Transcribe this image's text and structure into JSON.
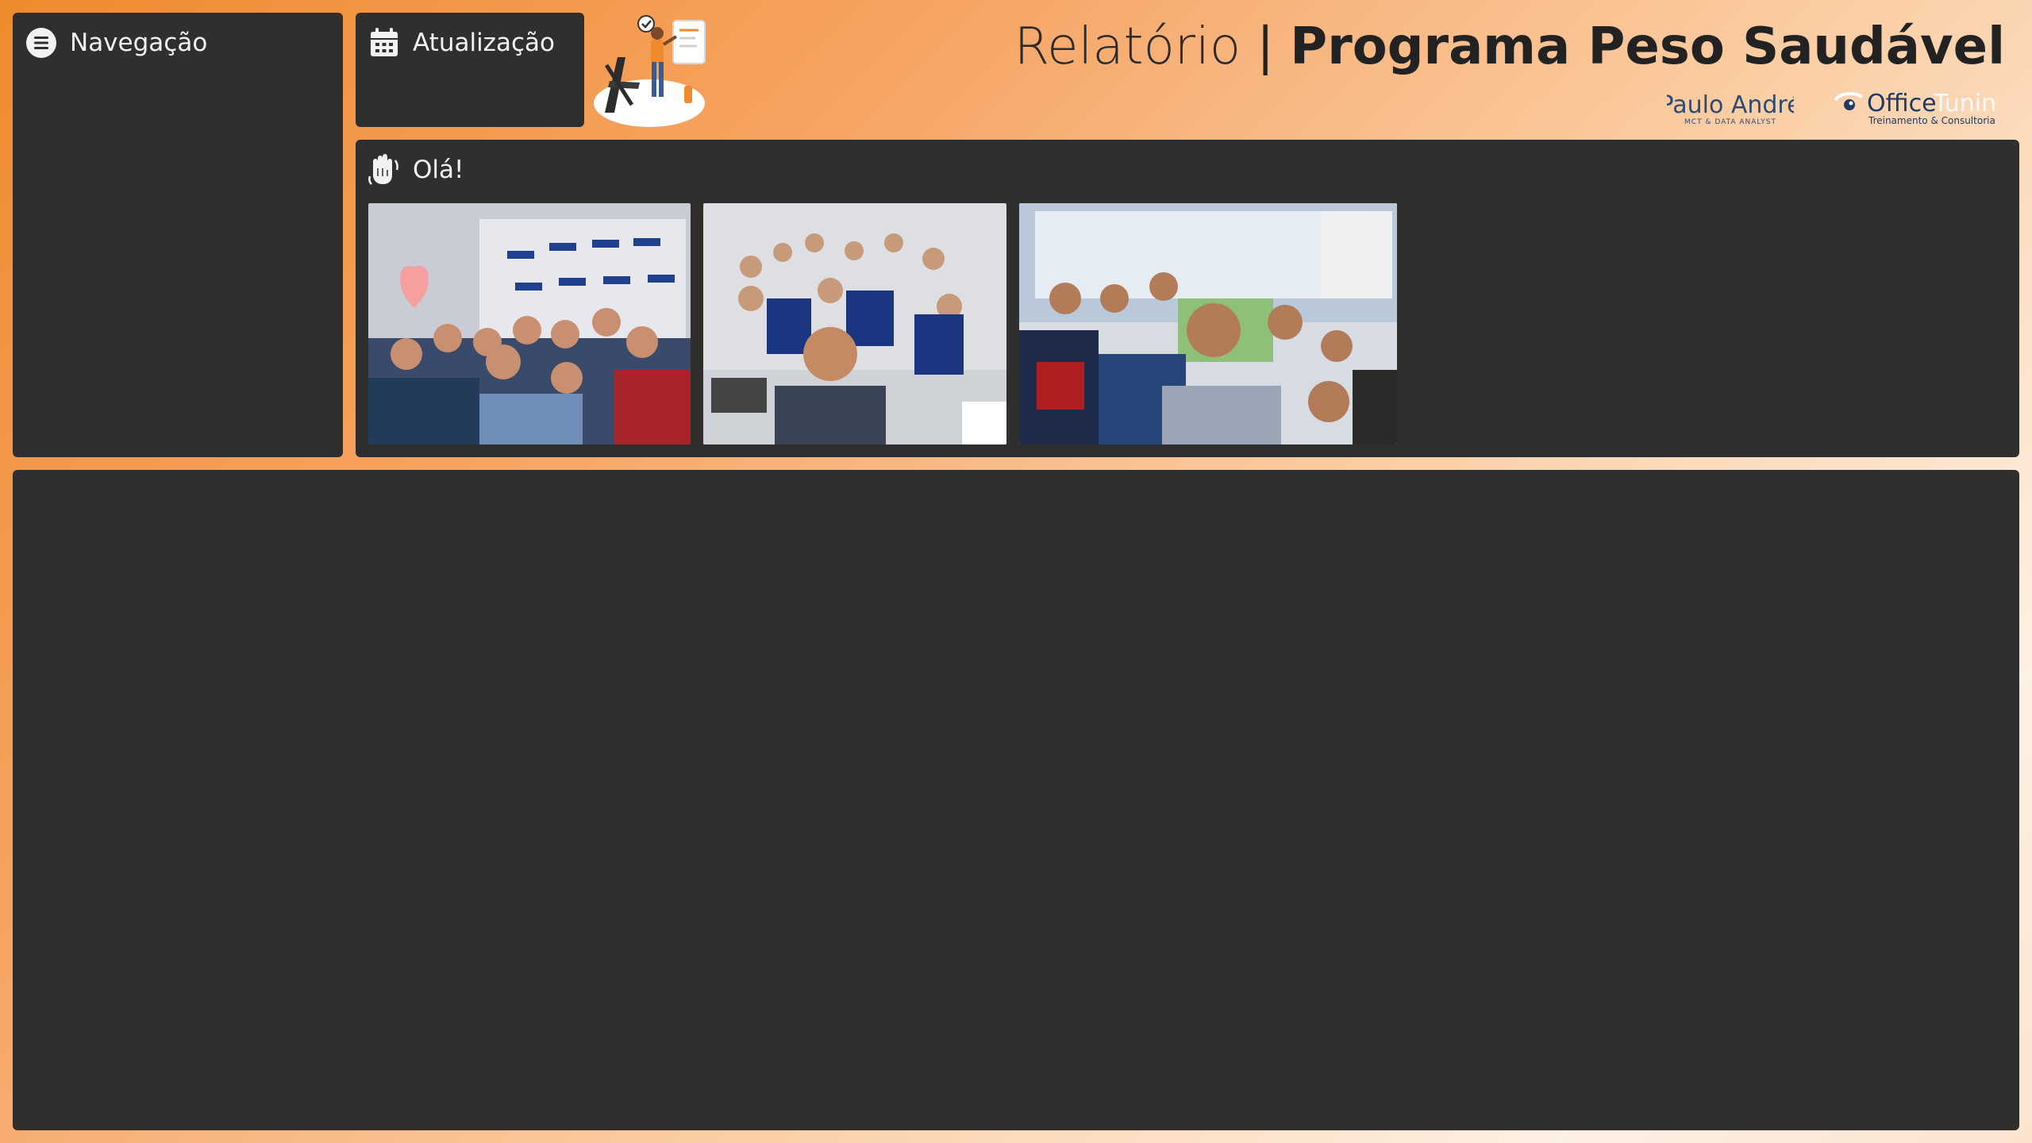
{
  "header": {
    "title_prefix": "Relatório",
    "title_sep": "|",
    "title_main": "Programa Peso Saudável",
    "logo_paulo_name": "Paulo André",
    "logo_paulo_sub": "MCT & DATA ANALYST",
    "logo_office_name_a": "Office",
    "logo_office_name_b": "Tuning",
    "logo_office_sub": "Treinamento & Consultoria"
  },
  "nav": {
    "label": "Navegação",
    "icon": "menu-icon"
  },
  "update": {
    "label": "Atualização",
    "icon": "calendar-icon"
  },
  "hello": {
    "label": "Olá!",
    "icon": "waving-hand-icon"
  },
  "colors": {
    "panel": "#302f2e",
    "text": "#f2f2f2",
    "title": "#222222",
    "accent": "#f08a2e"
  }
}
